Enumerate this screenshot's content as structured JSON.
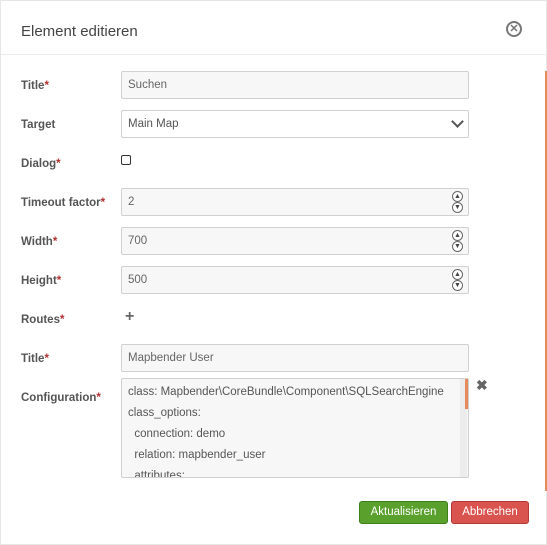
{
  "dialog": {
    "title": "Element editieren",
    "close_icon": "close-circle-icon"
  },
  "form": {
    "title_label": "Title",
    "title_value": "Suchen",
    "target_label": "Target",
    "target_value": "Main Map",
    "dialog_label": "Dialog",
    "dialog_checked": false,
    "timeout_label": "Timeout factor",
    "timeout_value": "2",
    "width_label": "Width",
    "width_value": "700",
    "height_label": "Height",
    "height_value": "500",
    "routes_label": "Routes",
    "route_title_label": "Title",
    "route_title_value": "Mapbender User",
    "configuration_label": "Configuration",
    "configuration_lines": [
      "class: Mapbender\\CoreBundle\\Component\\SQLSearchEngine",
      "class_options:",
      "  connection: demo",
      "  relation: mapbender_user",
      "  attributes:"
    ],
    "required_mark": "*"
  },
  "buttons": {
    "update_label": "Aktualisieren",
    "cancel_label": "Abbrechen"
  },
  "colors": {
    "accent": "#e58a5b",
    "update": "#5aa02c",
    "cancel": "#d9534f",
    "required": "#b03030"
  }
}
